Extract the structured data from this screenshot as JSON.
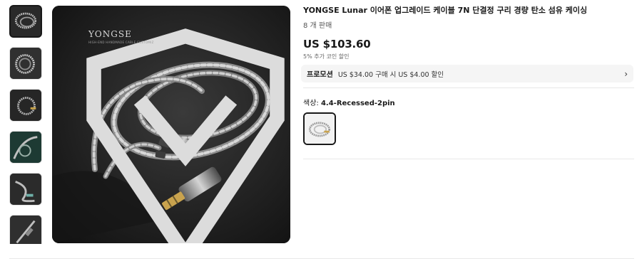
{
  "product": {
    "title": "YONGSE Lunar 이어폰 업그레이드 케이블 7N 단결정 구리 경량 탄소 섬유 케이싱",
    "sold": "8 개 판매",
    "price": "US $103.60",
    "coin_discount": "5% 추가 코인 할인"
  },
  "promotion": {
    "label": "프로모션",
    "text": "US $34.00 구매 시 US $4.00 할인"
  },
  "variant": {
    "label": "색상: ",
    "selected": "4.4-Recessed-2pin"
  },
  "image_brand": {
    "name": "YONGSE",
    "tagline": "HIGH-END HANDMADE CABLE CUSTOMIZ"
  },
  "colors": {
    "text": "#191919",
    "image_bg": "#1c1c1c",
    "promo_bg": "#f5f5f5"
  }
}
